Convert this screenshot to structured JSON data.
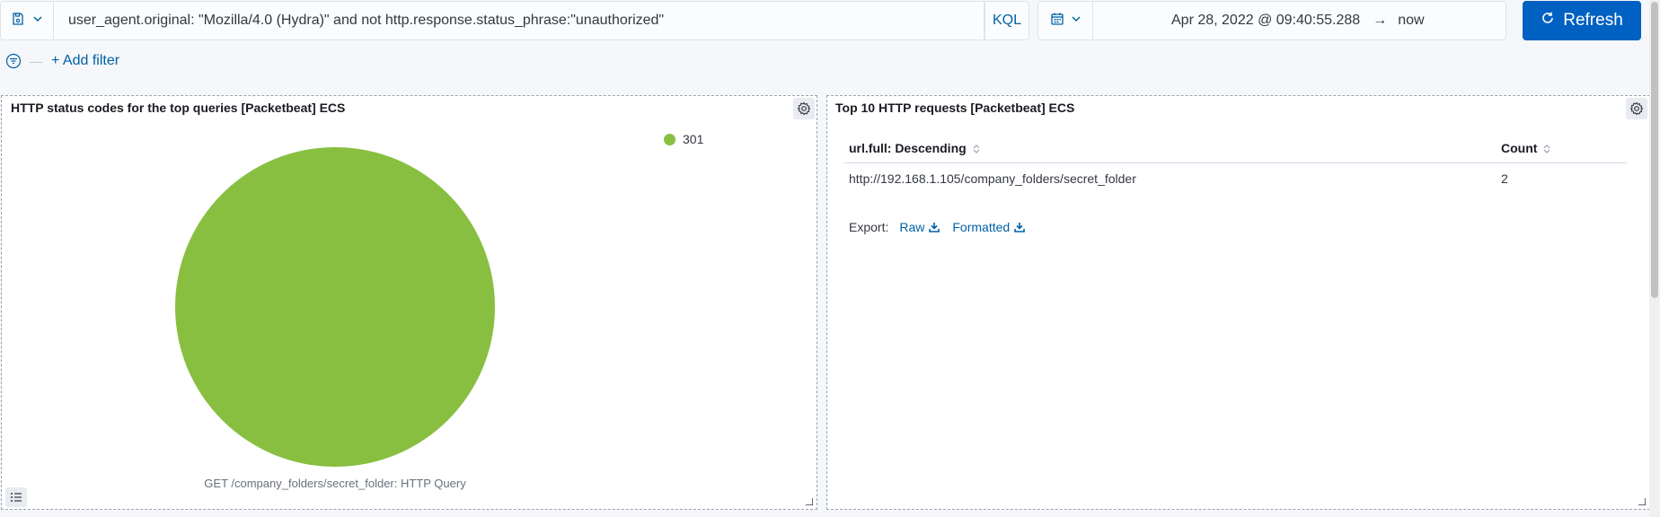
{
  "query": {
    "text": "user_agent.original: \"Mozilla/4.0 (Hydra)\" and not http.response.status_phrase:\"unauthorized\"",
    "language": "KQL"
  },
  "time": {
    "start": "Apr 28, 2022 @ 09:40:55.288",
    "end": "now"
  },
  "refresh_label": "Refresh",
  "filters": {
    "add_label": "+ Add filter"
  },
  "panels": {
    "left": {
      "title": "HTTP status codes for the top queries [Packetbeat] ECS",
      "legend_item": "301",
      "legend_color": "#88bf41",
      "pie_label": "GET /company_folders/secret_folder: HTTP Query"
    },
    "right": {
      "title": "Top 10 HTTP requests [Packetbeat] ECS",
      "columns": [
        "url.full: Descending",
        "Count"
      ],
      "rows": [
        [
          "http://192.168.1.105/company_folders/secret_folder",
          "2"
        ]
      ],
      "export_label": "Export:",
      "export_raw": "Raw",
      "export_formatted": "Formatted"
    }
  },
  "chart_data": {
    "type": "pie",
    "title": "HTTP status codes for the top queries [Packetbeat] ECS",
    "categories": [
      "301"
    ],
    "values": [
      1
    ],
    "colors": [
      "#88bf41"
    ],
    "xlabel": "GET /company_folders/secret_folder: HTTP Query",
    "legend_placement": "top-right"
  },
  "colors": {
    "accent": "#0061c2",
    "link": "#0061a6"
  }
}
